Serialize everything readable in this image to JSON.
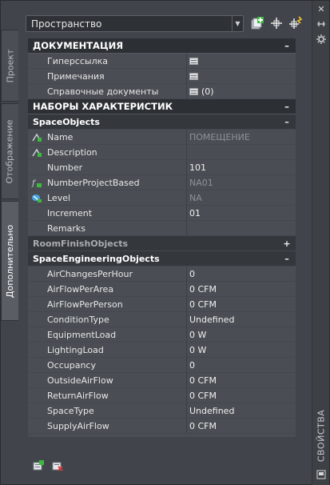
{
  "toolbar": {
    "style_dropdown_value": "Пространство"
  },
  "left_tabs": [
    {
      "label": "Проект",
      "active": false
    },
    {
      "label": "Отображение",
      "active": false
    },
    {
      "label": "Дополнительно",
      "active": true
    }
  ],
  "right_panel_title": "СВОЙСТВА",
  "sections": {
    "documentation": {
      "title": "ДОКУМЕНТАЦИЯ",
      "toggle": "–",
      "rows": [
        {
          "name": "Гиперссылка",
          "value": ""
        },
        {
          "name": "Примечания",
          "value": ""
        },
        {
          "name": "Справочные документы",
          "value": "(0)"
        }
      ]
    },
    "property_sets": {
      "title": "НАБОРЫ ХАРАКТЕРИСТИК",
      "toggle": "–"
    },
    "space_objects": {
      "title": "SpaceObjects",
      "toggle": "–",
      "rows": [
        {
          "name": "Name",
          "value": "ПОМЕЩЕНИЕ"
        },
        {
          "name": "Description",
          "value": ""
        },
        {
          "name": "Number",
          "value": "101"
        },
        {
          "name": "NumberProjectBased",
          "value": "NA01"
        },
        {
          "name": "Level",
          "value": "NA"
        },
        {
          "name": "Increment",
          "value": "01"
        },
        {
          "name": "Remarks",
          "value": ""
        }
      ]
    },
    "room_finish_objects": {
      "title": "RoomFinishObjects",
      "toggle": "+"
    },
    "space_engineering_objects": {
      "title": "SpaceEngineeringObjects",
      "toggle": "–",
      "rows": [
        {
          "name": "AirChangesPerHour",
          "value": "0"
        },
        {
          "name": "AirFlowPerArea",
          "value": "0 CFM"
        },
        {
          "name": "AirFlowPerPerson",
          "value": "0 CFM"
        },
        {
          "name": "ConditionType",
          "value": "Undefined"
        },
        {
          "name": "EquipmentLoad",
          "value": "0 W"
        },
        {
          "name": "LightingLoad",
          "value": "0 W"
        },
        {
          "name": "Occupancy",
          "value": "0"
        },
        {
          "name": "OutsideAirFlow",
          "value": "0 CFM"
        },
        {
          "name": "ReturnAirFlow",
          "value": "0 CFM"
        },
        {
          "name": "SpaceType",
          "value": "Undefined"
        },
        {
          "name": "SupplyAirFlow",
          "value": "0 CFM"
        }
      ]
    }
  },
  "colors": {
    "panel_bg": "#41454b",
    "grid_bg": "#4a4e54",
    "category_bg": "#2c2f34",
    "readonly_text": "#8e9297",
    "icon_green": "#3fb83f",
    "icon_blue": "#4aa3e0",
    "icon_red": "#d23a3a"
  },
  "icons": {
    "toolbar": [
      "add-property-set-icon",
      "select-objects-icon",
      "quick-select-icon"
    ],
    "right_strip": [
      "close-icon",
      "auto-hide-icon",
      "settings-icon",
      "properties-panel-icon"
    ],
    "bottom": [
      "add-property-sets-icon",
      "remove-property-sets-icon"
    ]
  }
}
